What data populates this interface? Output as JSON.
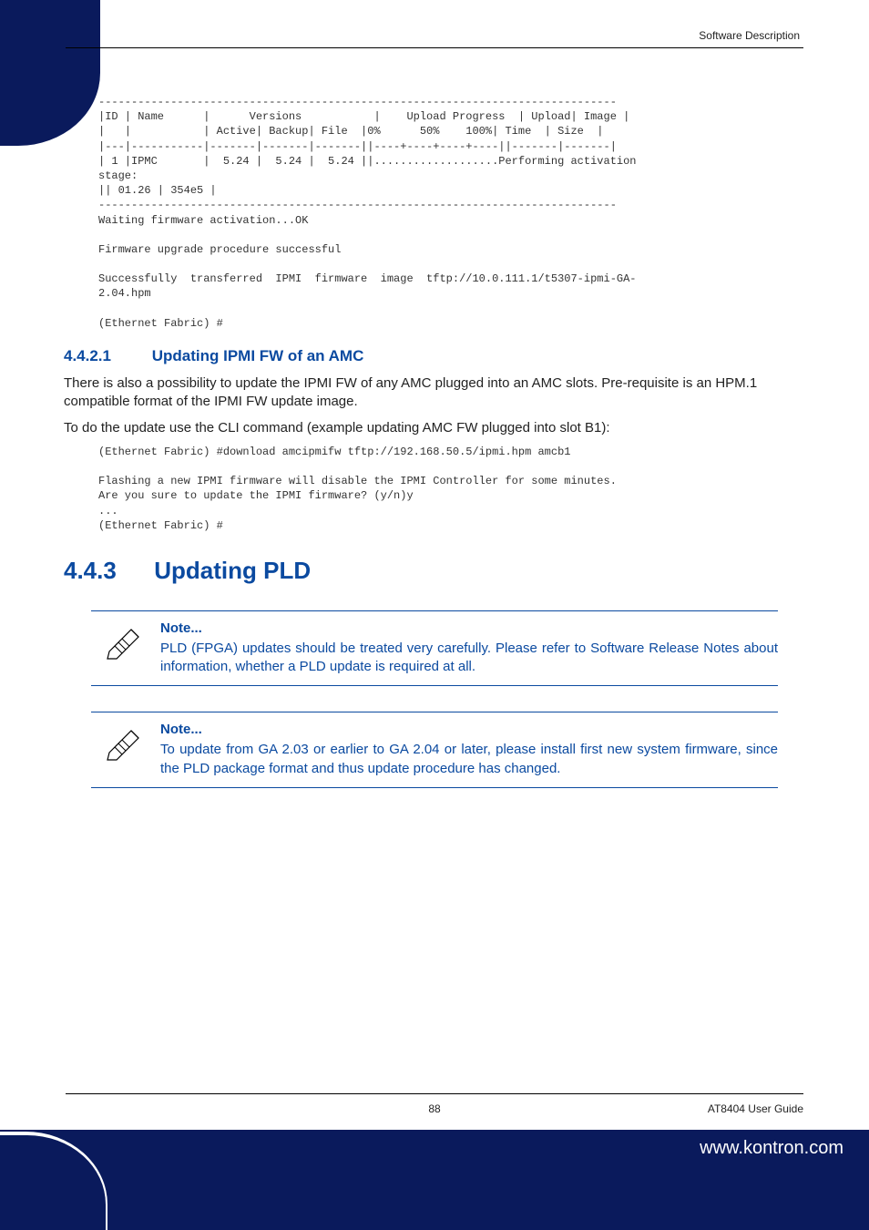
{
  "header": {
    "section_label": "Software Description"
  },
  "code_block_1": "-------------------------------------------------------------------------------\n|ID | Name      |      Versions           |    Upload Progress  | Upload| Image |\n|   |           | Active| Backup| File  |0%      50%    100%| Time  | Size  |\n|---|-----------|-------|-------|-------||----+----+----+----||-------|-------|\n| 1 |IPMC       |  5.24 |  5.24 |  5.24 ||...................Performing activation\nstage:\n|| 01.26 | 354e5 |\n-------------------------------------------------------------------------------\nWaiting firmware activation...OK\n\nFirmware upgrade procedure successful\n\nSuccessfully  transferred  IPMI  firmware  image  tftp://10.0.111.1/t5307-ipmi-GA-\n2.04.hpm\n\n(Ethernet Fabric) #",
  "subsection": {
    "number": "4.4.2.1",
    "title": "Updating IPMI FW of an AMC",
    "para1": "There is also a possibility to update the IPMI FW of any AMC plugged into an AMC slots. Pre-requisite is an HPM.1 compatible format of the IPMI FW update image.",
    "para2": "To do the update use the CLI command (example updating AMC FW plugged into slot B1):"
  },
  "code_block_2": "(Ethernet Fabric) #download amcipmifw tftp://192.168.50.5/ipmi.hpm amcb1\n\nFlashing a new IPMI firmware will disable the IPMI Controller for some minutes.\nAre you sure to update the IPMI firmware? (y/n)y\n...\n(Ethernet Fabric) #",
  "section": {
    "number": "4.4.3",
    "title": "Updating PLD"
  },
  "notes": [
    {
      "title": "Note...",
      "body": "PLD (FPGA) updates should be treated very carefully. Please refer to Software Release Notes about information, whether a PLD update is required at all."
    },
    {
      "title": "Note...",
      "body": "To update from GA 2.03 or earlier to GA 2.04 or later, please install first new system firmware, since the PLD package format and thus update procedure has changed."
    }
  ],
  "footer": {
    "page_number": "88",
    "doc_title": "AT8404 User Guide",
    "url": "www.kontron.com"
  }
}
